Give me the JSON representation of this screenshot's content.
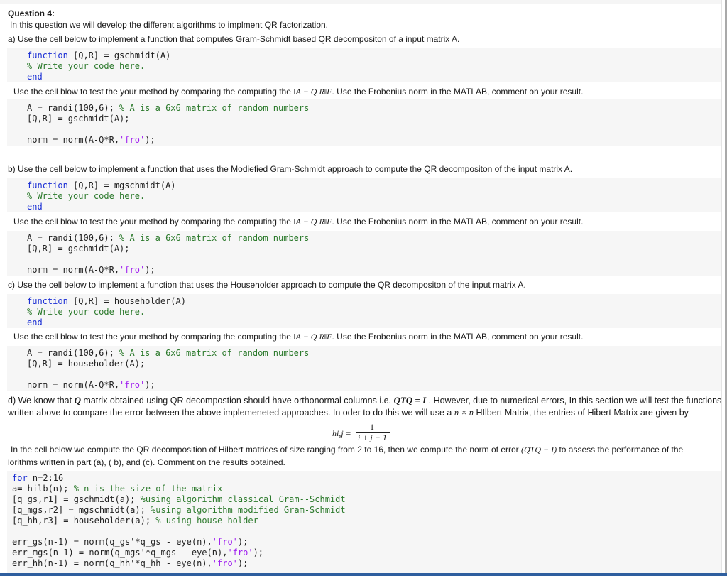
{
  "question_title": "Question 4:",
  "intro": "In this question we will develop the different algorithms to implment QR factorization.",
  "test_text": {
    "before": "Use the cell blow to test the your method by comparing the computing the ",
    "norm_expr": "‖A − Q R‖F",
    "after": ". Use the Frobenius  norm in the MATLAB, comment on your result."
  },
  "part_a": {
    "prompt": "a)  Use the cell below to implement a function that computes Gram-Schmidt based QR decompositon of a input matrix A.",
    "func_kw": "function",
    "func_sig": " [Q,R] = gschmidt(A)",
    "comment": "% Write your code here.",
    "end_kw": "end",
    "test_line1_code": "A = randi(100,6); ",
    "test_line1_comment": "% A is a 6x6 matrix of random numbers",
    "test_line2": "[Q,R] = gschmidt(A);",
    "test_line3_code": "norm = norm(A-Q*R,",
    "test_line3_str": "'fro'",
    "test_line3_end": ");"
  },
  "part_b": {
    "prompt": "b)  Use the cell below to implement a function that uses the Modiefied Gram-Schmidt approach to compute the  QR decompositon of  the input matrix A.",
    "func_kw": "function",
    "func_sig": " [Q,R] = mgschmidt(A)",
    "comment": "% Write your code here.",
    "end_kw": "end",
    "test_line1_code": "A = randi(100,6); ",
    "test_line1_comment": "% A is a 6x6 matrix of random numbers",
    "test_line2": "[Q,R] = gschmidt(A);",
    "test_line3_code": "norm = norm(A-Q*R,",
    "test_line3_str": "'fro'",
    "test_line3_end": ");"
  },
  "part_c": {
    "prompt": "c)  Use the cell below to implement a function that uses the Householder approach to compute the  QR decompositon of  the input matrix A.",
    "func_kw": "function",
    "func_sig": " [Q,R] = householder(A)",
    "comment": "% Write your code here.",
    "end_kw": "end",
    "test_line1_code": "A = randi(100,6); ",
    "test_line1_comment": "% A is a 6x6 matrix of random numbers",
    "test_line2": "[Q,R] = householder(A);",
    "test_line3_code": "norm = norm(A-Q*R,",
    "test_line3_str": "'fro'",
    "test_line3_end": ");"
  },
  "part_d": {
    "line1_a": "d) We know that ",
    "line1_q": "Q",
    "line1_b": " matrix obtained using QR decompostion should have orthonormal columns i.e. ",
    "line1_eq": "QTQ = I",
    "line1_c": " . However, due to numerical errors, In this section we will test the functions",
    "line2_a": "written above to compare the error between the above implemeneted approaches. In oder to do this we will use a ",
    "line2_nxn": "n × n",
    "line2_b": " HIlbert Matrix, the entries of Hibert Matrix are given by",
    "formula_lhs": "hi,j =",
    "formula_num": "1",
    "formula_den": "i + j − 1",
    "para2_line1_a": "In the cell below we compute the QR decomposition of Hilbert matrices of size ranging from 2 to 16, then we compute the norm of error ",
    "para2_expr": "(QTQ − I)",
    "para2_line1_b": " to assess the performance of the",
    "para2_line2": "lorithms written in part (a), ( b), and (c). Comment on the results obtained.",
    "code": {
      "l1_kw": "for",
      "l1_rest": " n=2:16",
      "l2_code": "a= hilb(n); ",
      "l2_cm": "% n is the size of the matrix",
      "l3_code": "[q_gs,r1] = gschmidt(a); ",
      "l3_cm": "%using algorithm classical Gram--Schmidt",
      "l4_code": "[q_mgs,r2] = mgschmidt(a); ",
      "l4_cm": "%using algorithm modified Gram-Schmidt",
      "l5_code": "[q_hh,r3] = householder(a); ",
      "l5_cm": "% using house holder",
      "l6_code": "err_gs(n-1) = norm(q_gs'*q_gs - eye(n),",
      "l7_code": "err_mgs(n-1) = norm(q_mgs'*q_mgs - eye(n),",
      "l8_code": "err_hh(n-1) = norm(q_hh'*q_hh - eye(n),",
      "str": "'fro'",
      "tail": ");"
    }
  }
}
